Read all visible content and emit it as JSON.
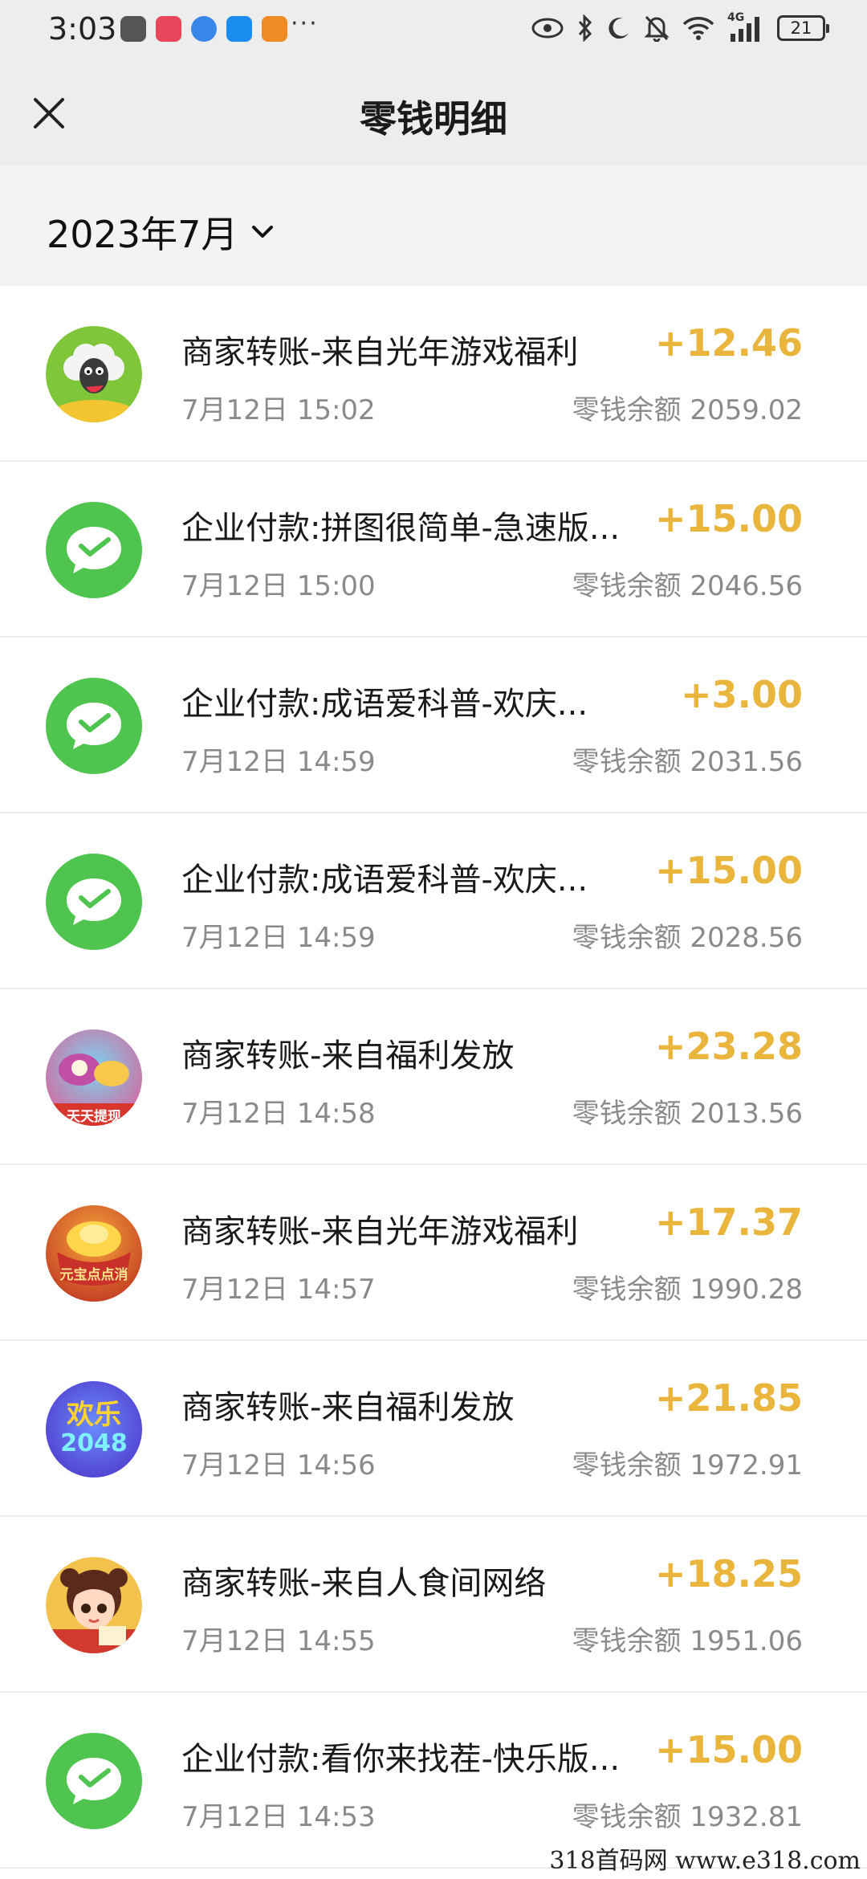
{
  "status_bar": {
    "time": "3:03",
    "more_indicator": "···",
    "battery_level": "21",
    "network": "4G",
    "icons": [
      "huawei-app-icon",
      "red-app-icon",
      "browser-app-icon",
      "weather-app-icon",
      "video-app-icon",
      "eye-icon",
      "bluetooth-icon",
      "moon-icon",
      "bell-off-icon",
      "wifi-icon",
      "signal-icon",
      "battery-icon"
    ]
  },
  "header": {
    "title": "零钱明细",
    "close_icon": "close-icon"
  },
  "filter": {
    "month": "2023年7月",
    "dropdown_icon": "chevron-down-icon"
  },
  "colors": {
    "amount": "#e9b53c",
    "wechat_green": "#4fc54f",
    "header_bg": "#ededed"
  },
  "transactions": [
    {
      "title": "商家转账-来自光年游戏福利",
      "amount": "+12.46",
      "time": "7月12日 15:02",
      "balance": "零钱余额 2059.02",
      "avatar": "sheep-game-avatar"
    },
    {
      "title": "企业付款:拼图很简单-急速版...",
      "amount": "+15.00",
      "time": "7月12日 15:00",
      "balance": "零钱余额 2046.56",
      "avatar": "wechat-pay-icon"
    },
    {
      "title": "企业付款:成语爱科普-欢庆...",
      "amount": "+3.00",
      "time": "7月12日 14:59",
      "balance": "零钱余额 2031.56",
      "avatar": "wechat-pay-icon"
    },
    {
      "title": "企业付款:成语爱科普-欢庆...",
      "amount": "+15.00",
      "time": "7月12日 14:59",
      "balance": "零钱余额 2028.56",
      "avatar": "wechat-pay-icon"
    },
    {
      "title": "商家转账-来自福利发放",
      "amount": "+23.28",
      "time": "7月12日 14:58",
      "balance": "零钱余额 2013.56",
      "avatar": "pearl-game-avatar"
    },
    {
      "title": "商家转账-来自光年游戏福利",
      "amount": "+17.37",
      "time": "7月12日 14:57",
      "balance": "零钱余额 1990.28",
      "avatar": "gold-ingot-game-avatar"
    },
    {
      "title": "商家转账-来自福利发放",
      "amount": "+21.85",
      "time": "7月12日 14:56",
      "balance": "零钱余额 1972.91",
      "avatar": "2048-game-avatar"
    },
    {
      "title": "商家转账-来自人食间网络",
      "amount": "+18.25",
      "time": "7月12日 14:55",
      "balance": "零钱余额 1951.06",
      "avatar": "girl-character-avatar"
    },
    {
      "title": "企业付款:看你来找茬-快乐版...",
      "amount": "+15.00",
      "time": "7月12日 14:53",
      "balance": "零钱余额 1932.81",
      "avatar": "wechat-pay-icon"
    }
  ],
  "avatar_text": {
    "pearl_game": "天天提现",
    "gold_game": "元宝点点消",
    "game_2048_top": "欢乐",
    "game_2048_bottom": "2048"
  },
  "watermark": "318首码网  www.e318.com"
}
